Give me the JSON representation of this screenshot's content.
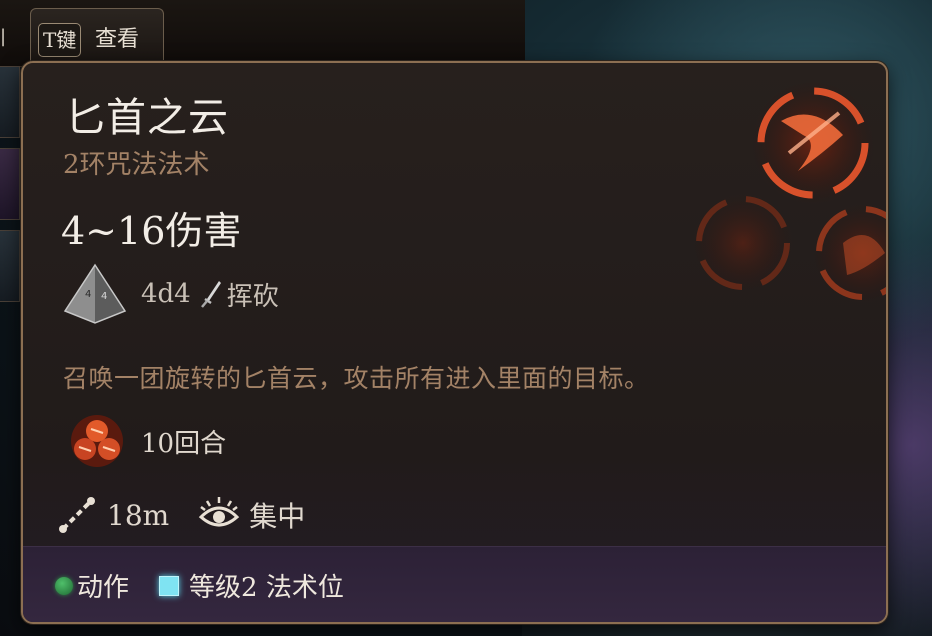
{
  "hotkey": {
    "key": "T键",
    "label": "查看"
  },
  "background": {
    "left_edge_char": "|"
  },
  "spell": {
    "name": "匕首之云",
    "type": "2环咒法法术",
    "damage": "4~16伤害",
    "dice": "4d4",
    "damage_type": "挥砍",
    "description": "召唤一团旋转的匕首云，攻击所有进入里面的目标。",
    "duration": "10回合",
    "range": "18m",
    "concentration": "集中"
  },
  "footer": {
    "action_label": "动作",
    "slot_label": "等级2 法术位"
  },
  "icons": {
    "dice": "d4-dice-icon",
    "damage_type": "slashing-sword-icon",
    "duration": "cloud-of-daggers-duration-icon",
    "range": "range-icon",
    "concentration": "concentration-eye-icon",
    "action": "action-dot-icon",
    "spell_slot": "spell-slot-icon"
  },
  "colors": {
    "title": "#f2ede6",
    "subtitle": "#a38266",
    "border": "#8c6f52",
    "action_green": "#2e8a48",
    "spell_slot_cyan": "#7fe3f2",
    "spell_accent": "#e2542c"
  }
}
